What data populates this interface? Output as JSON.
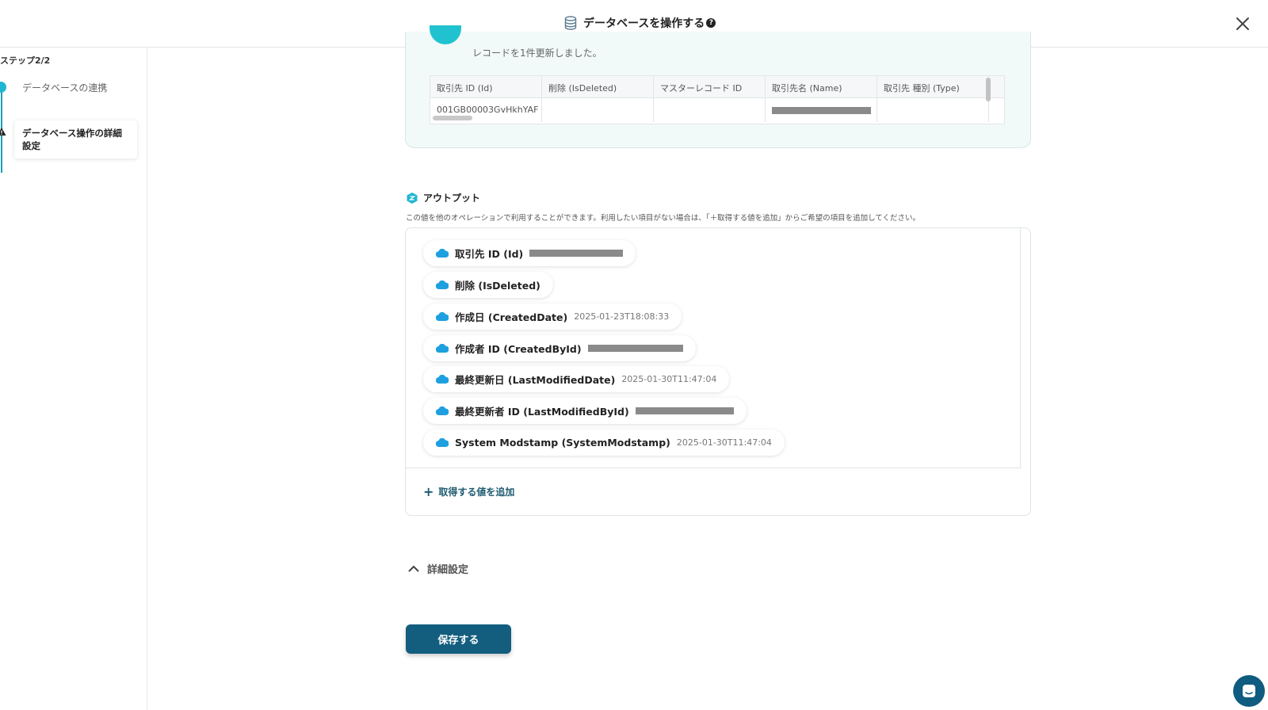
{
  "header": {
    "title": "データベースを操作する",
    "help_glyph": "?"
  },
  "sidebar": {
    "step_label": "ステップ2/2",
    "steps": [
      {
        "label": "データベースの連携",
        "state": "done"
      },
      {
        "label": "データベース操作の詳細設定",
        "state": "active"
      }
    ]
  },
  "result": {
    "message": "レコードを1件更新しました。",
    "columns": [
      "取引先 ID (Id)",
      "削除 (IsDeleted)",
      "マスターレコード ID",
      "取引先名 (Name)",
      "取引先 種別 (Type)"
    ],
    "row": [
      "001GB00003GvHkhYAF",
      "",
      "",
      "",
      ""
    ]
  },
  "output": {
    "title": "アウトプット",
    "description": "この値を他のオペレーションで利用することができます。利用したい項目がない場合は、「＋取得する値を追加」からご希望の項目を追加してください。",
    "items": [
      {
        "label": "取引先 ID (Id)",
        "value": ""
      },
      {
        "label": "削除 (IsDeleted)",
        "value": ""
      },
      {
        "label": "作成日 (CreatedDate)",
        "value": "2025-01-23T18:08:33"
      },
      {
        "label": "作成者 ID (CreatedById)",
        "value": ""
      },
      {
        "label": "最終更新日 (LastModifiedDate)",
        "value": "2025-01-30T11:47:04"
      },
      {
        "label": "最終更新者 ID (LastModifiedById)",
        "value": ""
      },
      {
        "label": "System Modstamp (SystemModstamp)",
        "value": "2025-01-30T11:47:04"
      }
    ],
    "add_label": "取得する値を追加"
  },
  "advanced": {
    "label": "詳細設定"
  },
  "save_label": "保存する",
  "colors": {
    "primary": "#135e7e",
    "accent": "#1fb6d1",
    "salesforce": "#1ea0e0"
  }
}
